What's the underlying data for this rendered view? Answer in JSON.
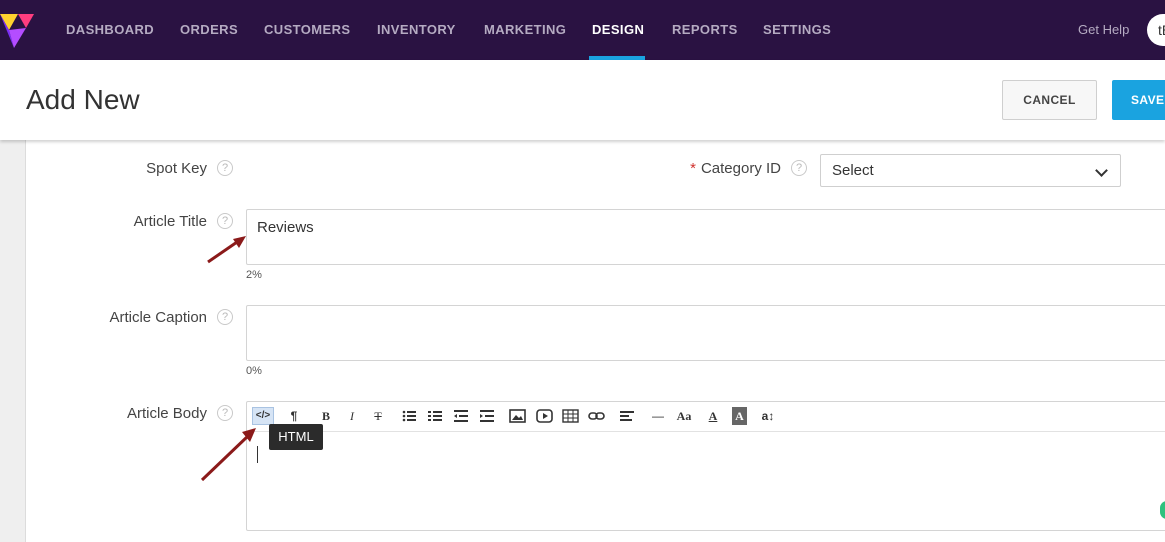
{
  "nav": {
    "items": [
      "DASHBOARD",
      "ORDERS",
      "CUSTOMERS",
      "INVENTORY",
      "MARKETING",
      "DESIGN",
      "REPORTS",
      "SETTINGS"
    ],
    "active": "DESIGN",
    "help": "Get Help",
    "user_initials": "tE"
  },
  "header": {
    "title": "Add New",
    "cancel_label": "CANCEL",
    "save_label": "SAVE"
  },
  "form": {
    "spot_key_label": "Spot Key",
    "category_required": "*",
    "category_label": "Category ID",
    "category_value": "Select",
    "title_label": "Article Title",
    "title_value": "Reviews",
    "title_counter": "2%",
    "caption_label": "Article Caption",
    "caption_value": "",
    "caption_counter": "0%",
    "body_label": "Article Body",
    "help_glyph": "?"
  },
  "editor": {
    "toolbar": [
      {
        "name": "html-icon",
        "glyph": "</>"
      },
      {
        "name": "paragraph-icon",
        "glyph": "¶"
      },
      {
        "name": "bold-icon",
        "glyph": "B"
      },
      {
        "name": "italic-icon",
        "glyph": "I"
      },
      {
        "name": "strikethrough-icon",
        "glyph": "T"
      },
      {
        "name": "bullet-list-icon",
        "glyph": ""
      },
      {
        "name": "numbered-list-icon",
        "glyph": ""
      },
      {
        "name": "outdent-icon",
        "glyph": ""
      },
      {
        "name": "indent-icon",
        "glyph": ""
      },
      {
        "name": "image-icon",
        "glyph": ""
      },
      {
        "name": "video-icon",
        "glyph": ""
      },
      {
        "name": "table-icon",
        "glyph": ""
      },
      {
        "name": "link-icon",
        "glyph": ""
      },
      {
        "name": "align-icon",
        "glyph": ""
      },
      {
        "name": "horizontal-rule-icon",
        "glyph": "—"
      },
      {
        "name": "font-icon",
        "glyph": "Aa"
      },
      {
        "name": "font-color-icon",
        "glyph": "A"
      },
      {
        "name": "background-color-icon",
        "glyph": "A"
      },
      {
        "name": "font-size-icon",
        "glyph": "a↕"
      }
    ],
    "tooltip": "HTML"
  },
  "colors": {
    "nav_bg": "#2a1242",
    "accent": "#1aa3e0",
    "annotation_arrow": "#8b1a1a"
  }
}
